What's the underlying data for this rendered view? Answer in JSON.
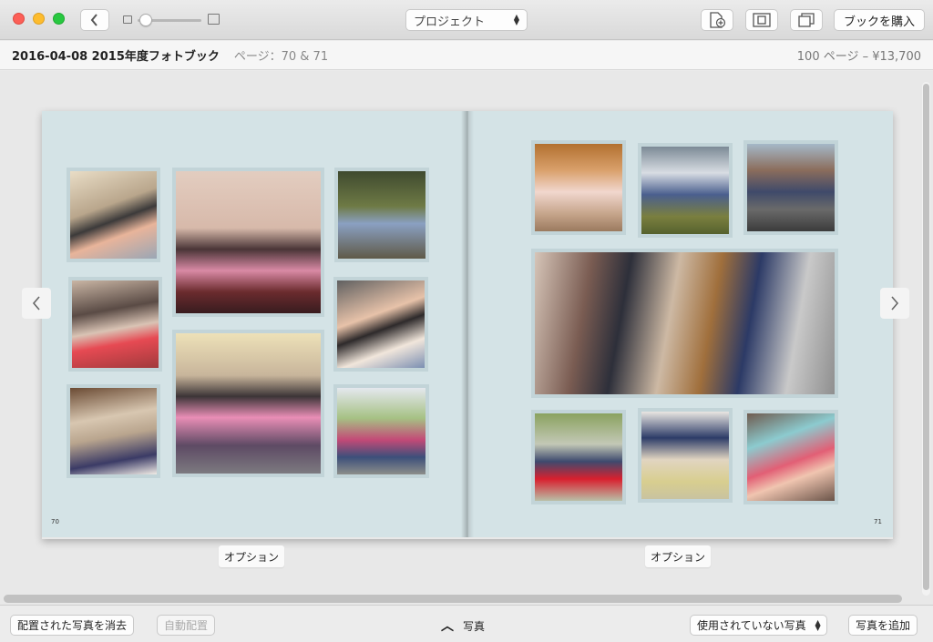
{
  "toolbar": {
    "project_label": "プロジェクト",
    "buy_label": "ブックを購入",
    "icons": [
      "back-icon",
      "add-page-icon",
      "layout-icon",
      "page-copy-icon"
    ]
  },
  "info": {
    "book_title": "2016-04-08 2015年度フォトブック",
    "page_label": "ページ：70 & 71",
    "price": "100 ページ – ¥13,700"
  },
  "spread": {
    "left_page_number": "70",
    "right_page_number": "71",
    "left_option": "オプション",
    "right_option": "オプション"
  },
  "bottom": {
    "clear_label": "配置された写真を消去",
    "autoplace_label": "自動配置",
    "photos_label": "写真",
    "unused_label": "使用されていない写真",
    "add_label": "写真を追加"
  },
  "colors": {
    "page": "#d4e3e6",
    "frame": "#c2d4d8",
    "close": "#fc5f57",
    "minimize": "#fdbc2e",
    "maximize": "#28c840"
  }
}
